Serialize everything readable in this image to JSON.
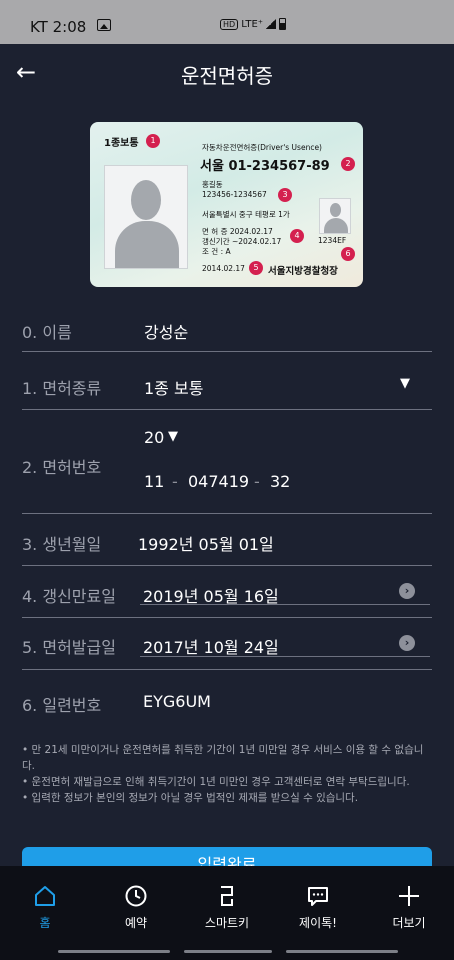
{
  "status_bar": {
    "carrier_time": "KT 2:08",
    "hd": "HD",
    "lte": "LTE⁺"
  },
  "header": {
    "title": "운전면허증"
  },
  "card": {
    "type": "1종보통",
    "heading": "자동차운전면허증(Driver's Usence)",
    "number": "서울 01-234567-89",
    "name": "홍길동",
    "id": "123456-1234567",
    "address": "서울특별시 중구 테평로 1가",
    "issue": "면 허 증   2024.02.17",
    "renew": "갱신기간   ~2024.02.17",
    "cond": "조      건 : A",
    "serial": "1234EF",
    "date": "2014.02.17",
    "agency": "서울지방경찰청장",
    "badges": [
      "1",
      "2",
      "3",
      "4",
      "5",
      "6"
    ]
  },
  "form": {
    "name": {
      "label": "0. 이름",
      "value": "강성순"
    },
    "license_type": {
      "label": "1. 면허종류",
      "value": "1종 보통"
    },
    "license_number": {
      "label": "2. 면허번호",
      "region": "20",
      "part1": "11",
      "part2": "047419",
      "part3": "32",
      "dash": "-"
    },
    "birth": {
      "label": "3. 생년월일",
      "value": "1992년 05월 01일"
    },
    "renew_expiry": {
      "label": "4. 갱신만료일",
      "value": "2019년 05월 16일"
    },
    "issue_date": {
      "label": "5. 면허발급일",
      "value": "2017년 10월 24일"
    },
    "serial": {
      "label": "6. 일련번호",
      "value": "EYG6UM"
    }
  },
  "notes": [
    "• 만 21세 미만이거나 운전면허를 취득한 기간이 1년 미만일 경우 서비스 이용 할 수 없습니다.",
    "• 운전면허 재발급으로 인해 취득기간이 1년 미만인 경우 고객센터로 연락 부탁드립니다.",
    "• 입력한 정보가 본인의 정보가 아닐 경우 법적인 제재를 받으실 수 있습니다."
  ],
  "confirm_button": "입력완료",
  "nav": [
    {
      "label": "홈",
      "icon": "home-icon"
    },
    {
      "label": "예약",
      "icon": "clock-icon"
    },
    {
      "label": "스마트키",
      "icon": "smartkey-icon"
    },
    {
      "label": "제이톡!",
      "icon": "chat-icon"
    },
    {
      "label": "더보기",
      "icon": "plus-icon"
    }
  ],
  "colors": {
    "accent": "#1f9ee8",
    "background": "#1c2130",
    "badge": "#d4204f"
  }
}
